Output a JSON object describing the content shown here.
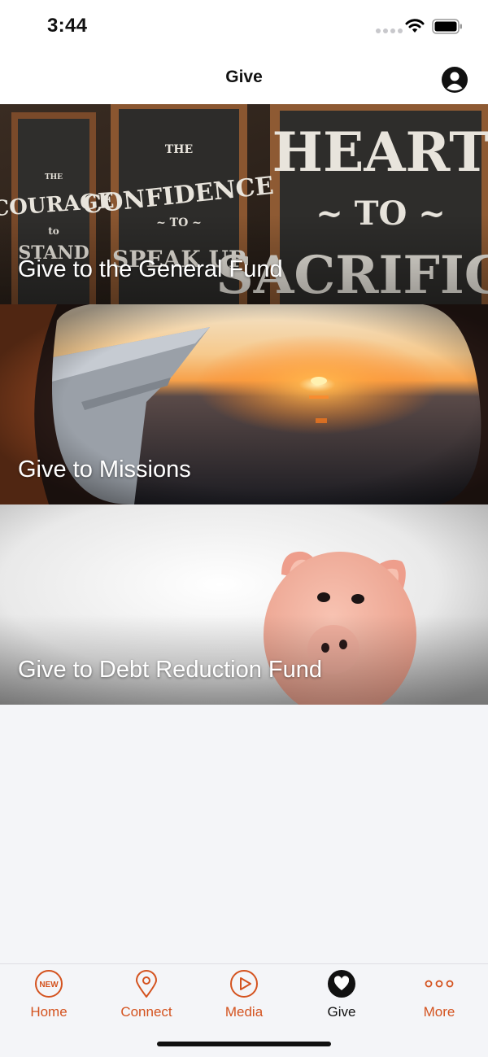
{
  "status_bar": {
    "time": "3:44",
    "signal_icon": "signal-dots-icon",
    "wifi_icon": "wifi-icon",
    "battery_icon": "battery-icon"
  },
  "nav": {
    "title": "Give",
    "profile_icon": "person-circle-icon"
  },
  "give_options": [
    {
      "label": "Give to the General Fund",
      "image": "chalkboard signs: Courage, Confidence, Heart to Sacrifice"
    },
    {
      "label": "Give to Missions",
      "image": "airplane window sunset"
    },
    {
      "label": "Give to Debt Reduction Fund",
      "image": "pink piggy bank"
    }
  ],
  "tab_bar": {
    "tabs": [
      {
        "label": "Home",
        "icon": "new-badge-icon",
        "active": false
      },
      {
        "label": "Connect",
        "icon": "location-pin-icon",
        "active": false
      },
      {
        "label": "Media",
        "icon": "play-circle-icon",
        "active": false
      },
      {
        "label": "Give",
        "icon": "heart-circle-icon",
        "active": true
      },
      {
        "label": "More",
        "icon": "more-dots-icon",
        "active": false
      }
    ],
    "accent_color": "#d4531f",
    "active_color": "#111111"
  }
}
